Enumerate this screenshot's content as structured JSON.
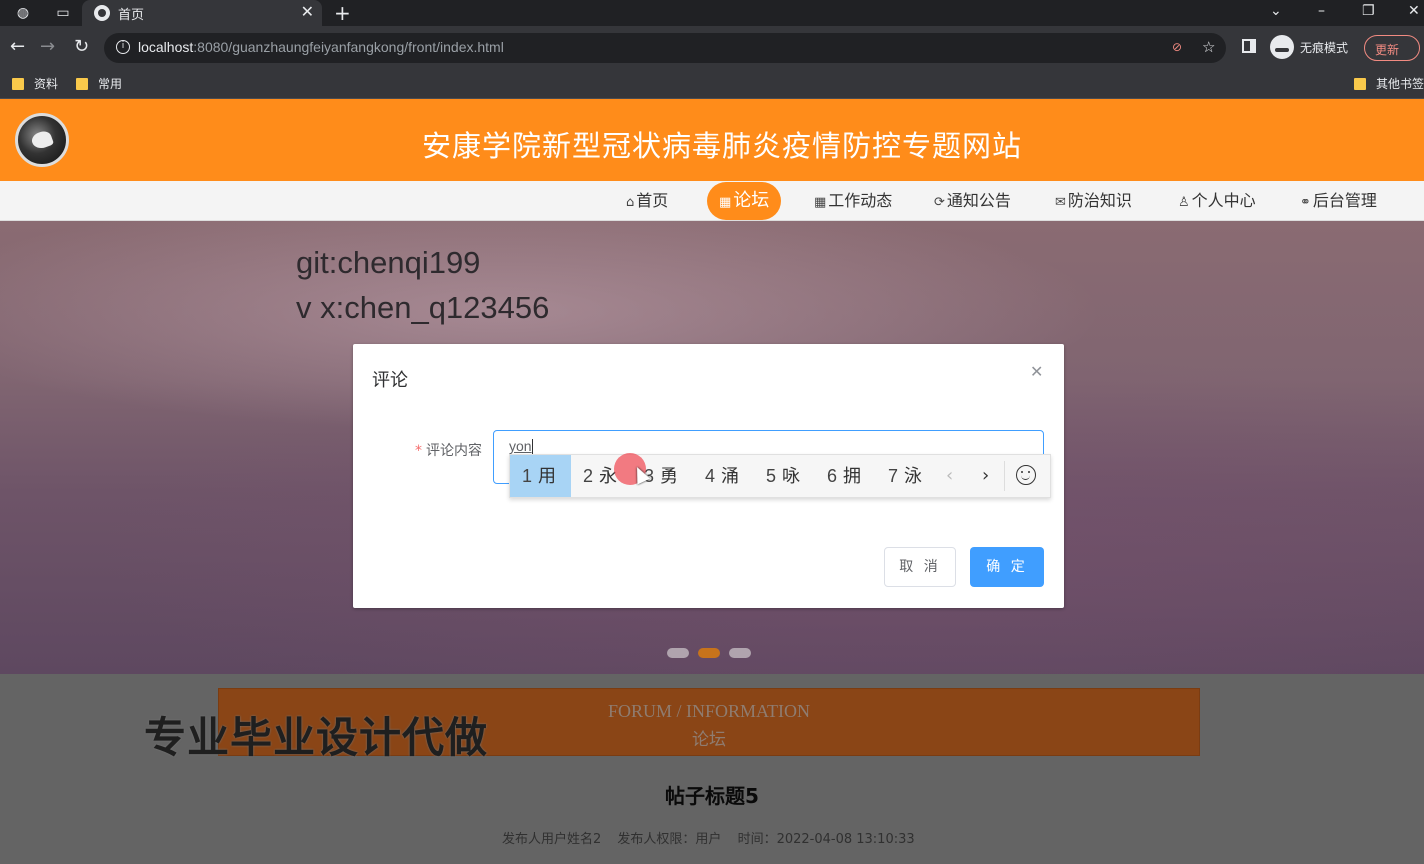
{
  "browser": {
    "tab_title": "首页",
    "url_host": "localhost",
    "url_rest": ":8080/guanzhaungfeiyanfangkong/front/index.html",
    "incognito_label": "无痕模式",
    "update_label": "更新",
    "bookmarks": [
      "资料",
      "常用"
    ],
    "other_bookmarks": "其他书签"
  },
  "site": {
    "title": "安康学院新型冠状病毒肺炎疫情防控专题网站",
    "nav": [
      {
        "label": "首页",
        "icon": "home-icon"
      },
      {
        "label": "论坛",
        "icon": "forum-icon",
        "active": true
      },
      {
        "label": "工作动态",
        "icon": "grid-icon"
      },
      {
        "label": "通知公告",
        "icon": "refresh-icon"
      },
      {
        "label": "防治知识",
        "icon": "mail-icon"
      },
      {
        "label": "个人中心",
        "icon": "user-icon"
      },
      {
        "label": "后台管理",
        "icon": "link-icon"
      }
    ]
  },
  "banner": {
    "line1": "git:chenqi199",
    "line2": "v x:chen_q123456",
    "active_slide": 2,
    "slide_count": 3
  },
  "section": {
    "en": "FORUM / INFORMATION",
    "cn": "论坛"
  },
  "promo_text": "专业毕业设计代做",
  "post": {
    "title": "帖子标题5",
    "author": "发布人用户姓名2",
    "role": "发布人权限：用户",
    "time": "时间：2022-04-08 13:10:33"
  },
  "dialog": {
    "title": "评论",
    "label": "评论内容",
    "typed": "yon",
    "cancel": "取 消",
    "confirm": "确 定"
  },
  "ime": {
    "candidates": [
      {
        "num": "1",
        "char": "用"
      },
      {
        "num": "2",
        "char": "永"
      },
      {
        "num": "3",
        "char": "勇"
      },
      {
        "num": "4",
        "char": "涌"
      },
      {
        "num": "5",
        "char": "咏"
      },
      {
        "num": "6",
        "char": "拥"
      },
      {
        "num": "7",
        "char": "泳"
      }
    ],
    "selected_index": 0
  },
  "colors": {
    "brand_orange": "#ff8c1a",
    "primary_blue": "#409eff"
  }
}
